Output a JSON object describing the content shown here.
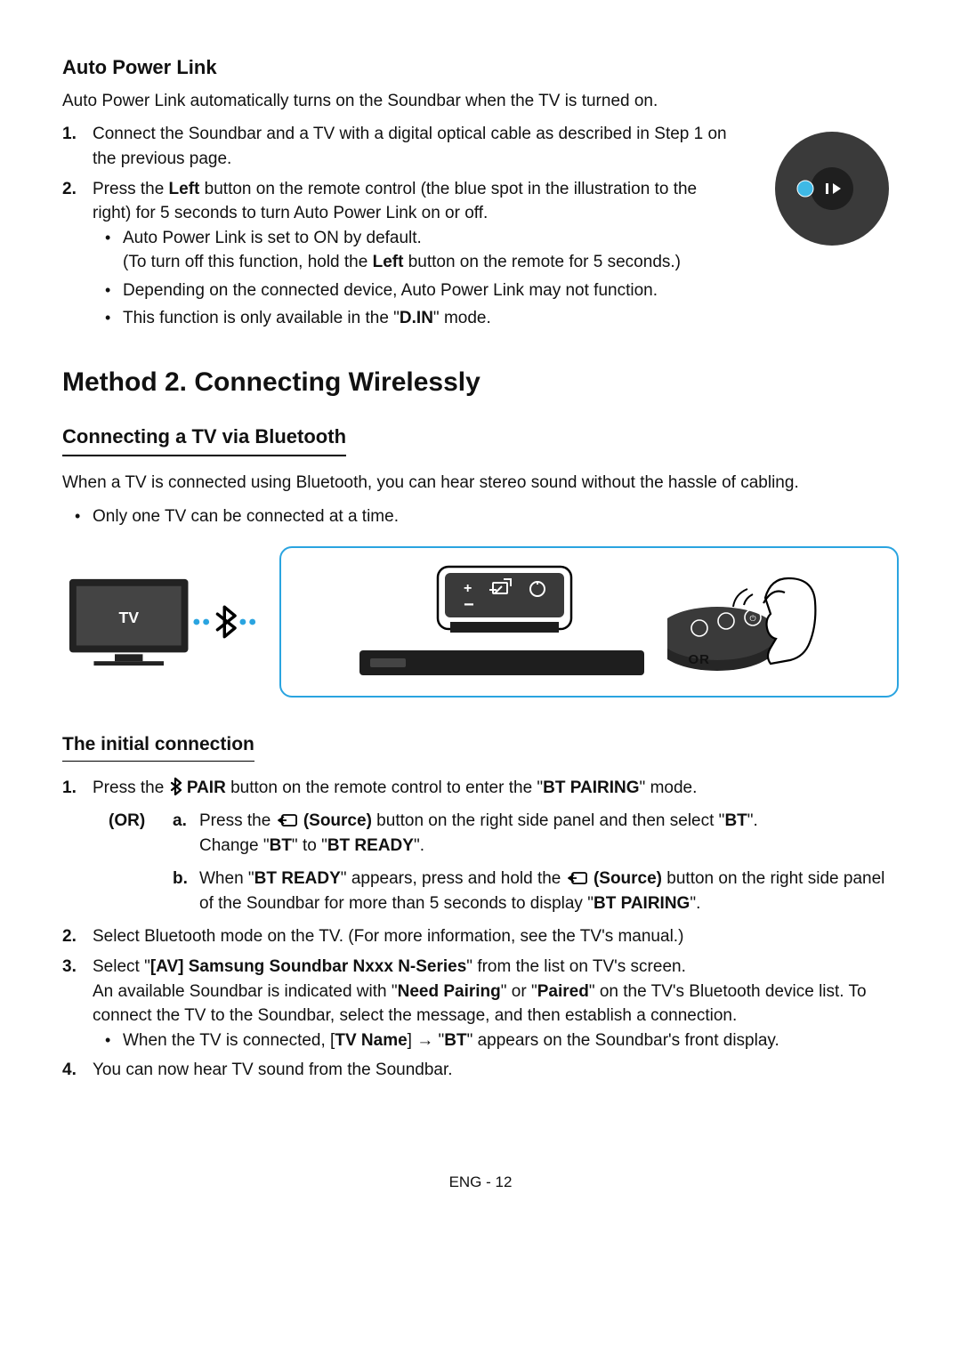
{
  "s1": {
    "title": "Auto Power Link",
    "intro": "Auto Power Link automatically turns on the Soundbar when the TV is turned on.",
    "step1_pre": "Connect the Soundbar and a TV with a digital optical cable as described in Step 1 on the previous page.",
    "step2_a": "Press the ",
    "step2_left": "Left",
    "step2_b": " button on the remote control (the blue spot in the illustration to the right) for 5 seconds to turn Auto Power Link on or off.",
    "b1a": "Auto Power Link is set to ON by default.",
    "b1b_a": "(To turn off this function, hold the ",
    "b1b_left": "Left",
    "b1b_b": " button on the remote for 5 seconds.)",
    "b2": "Depending on the connected device, Auto Power Link may not function.",
    "b3_a": "This function is only available in the \"",
    "b3_din": "D.IN",
    "b3_b": "\" mode."
  },
  "m2": {
    "title": "Method 2. Connecting Wirelessly",
    "sub": "Connecting a TV via Bluetooth",
    "intro": "When a TV is connected using Bluetooth, you can hear stereo sound without the hassle of cabling.",
    "only": "Only one TV can be connected at a time.",
    "tv_label": "TV",
    "or_label": "OR"
  },
  "ic": {
    "title": "The initial connection",
    "s1_a": "Press the ",
    "s1_pair": "PAIR",
    "s1_b": " button on the remote control to enter the \"",
    "s1_btp": "BT PAIRING",
    "s1_c": "\" mode.",
    "or": "(OR)",
    "a_a": "Press the ",
    "a_src": "(Source)",
    "a_b": " button on the right side panel and then select \"",
    "a_bt": "BT",
    "a_c": "\".",
    "a2_a": "Change \"",
    "a2_bt": "BT",
    "a2_b": "\" to \"",
    "a2_br": "BT READY",
    "a2_c": "\".",
    "b_a": "When \"",
    "b_br": "BT READY",
    "b_b": "\" appears, press and hold the ",
    "b_src": "(Source)",
    "b_c": " button on the right side panel of the Soundbar for more than 5 seconds to display \"",
    "b_btp": "BT PAIRING",
    "b_d": "\".",
    "s2": "Select Bluetooth mode on the TV. (For more information, see the TV's manual.)",
    "s3_a": "Select \"",
    "s3_av": "[AV] Samsung Soundbar Nxxx N-Series",
    "s3_b": "\" from the list on TV's screen.",
    "s3_c": "An available Soundbar is indicated with \"",
    "s3_np": "Need Pairing",
    "s3_d": "\" or \"",
    "s3_p": "Paired",
    "s3_e": "\" on the TV's Bluetooth device list. To connect the TV to the Soundbar, select the message, and then establish a connection.",
    "s3_bul_a": "When the TV is connected, [",
    "s3_bul_tv": "TV Name",
    "s3_bul_b": "] → \"",
    "s3_bul_bt": "BT",
    "s3_bul_c": "\" appears on the Soundbar's front display.",
    "s4": "You can now hear TV sound from the Soundbar."
  },
  "footer": "ENG - 12",
  "markers": {
    "n1": "1.",
    "n2": "2.",
    "n3": "3.",
    "n4": "4.",
    "la": "a.",
    "lb": "b."
  }
}
